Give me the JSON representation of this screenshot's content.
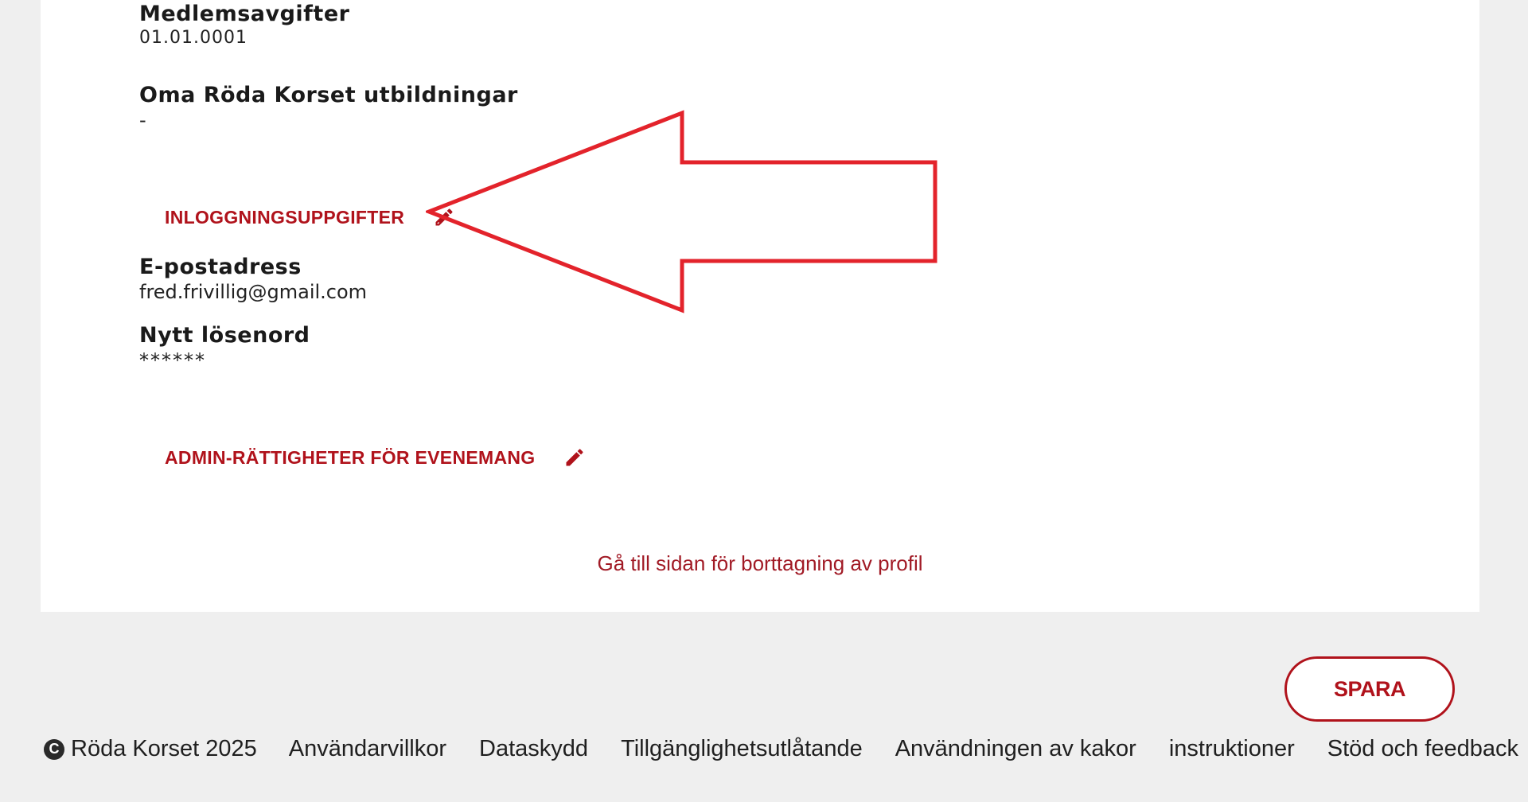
{
  "profile": {
    "membership_fees": {
      "label": "Medlemsavgifter",
      "value": "01.01.0001"
    },
    "trainings": {
      "label": "Oma Röda Korset utbildningar",
      "value": "-"
    }
  },
  "login_section": {
    "title": "INLOGGNINGSUPPGIFTER",
    "edit_icon": "pencil-icon",
    "email": {
      "label": "E-postadress",
      "value": "fred.frivillig@gmail.com"
    },
    "password": {
      "label": "Nytt lösenord",
      "value": "******"
    }
  },
  "admin_section": {
    "title": "ADMIN-RÄTTIGHETER FÖR EVENEMANG",
    "edit_icon": "pencil-icon"
  },
  "delete_profile_link": "Gå till sidan för borttagning av profil",
  "save_button": "SPARA",
  "footer": {
    "copyright_icon": "copyright-icon",
    "copyright_glyph": "C",
    "copyright": "Röda Korset 2025",
    "links": [
      "Användarvillkor",
      "Dataskydd",
      "Tillgänglighetsutlåtande",
      "Användningen av kakor",
      "instruktioner",
      "Stöd och feedback"
    ]
  },
  "colors": {
    "accent": "#b0121b",
    "annotation_arrow": "#e3232b",
    "page_bg": "#efefef"
  }
}
